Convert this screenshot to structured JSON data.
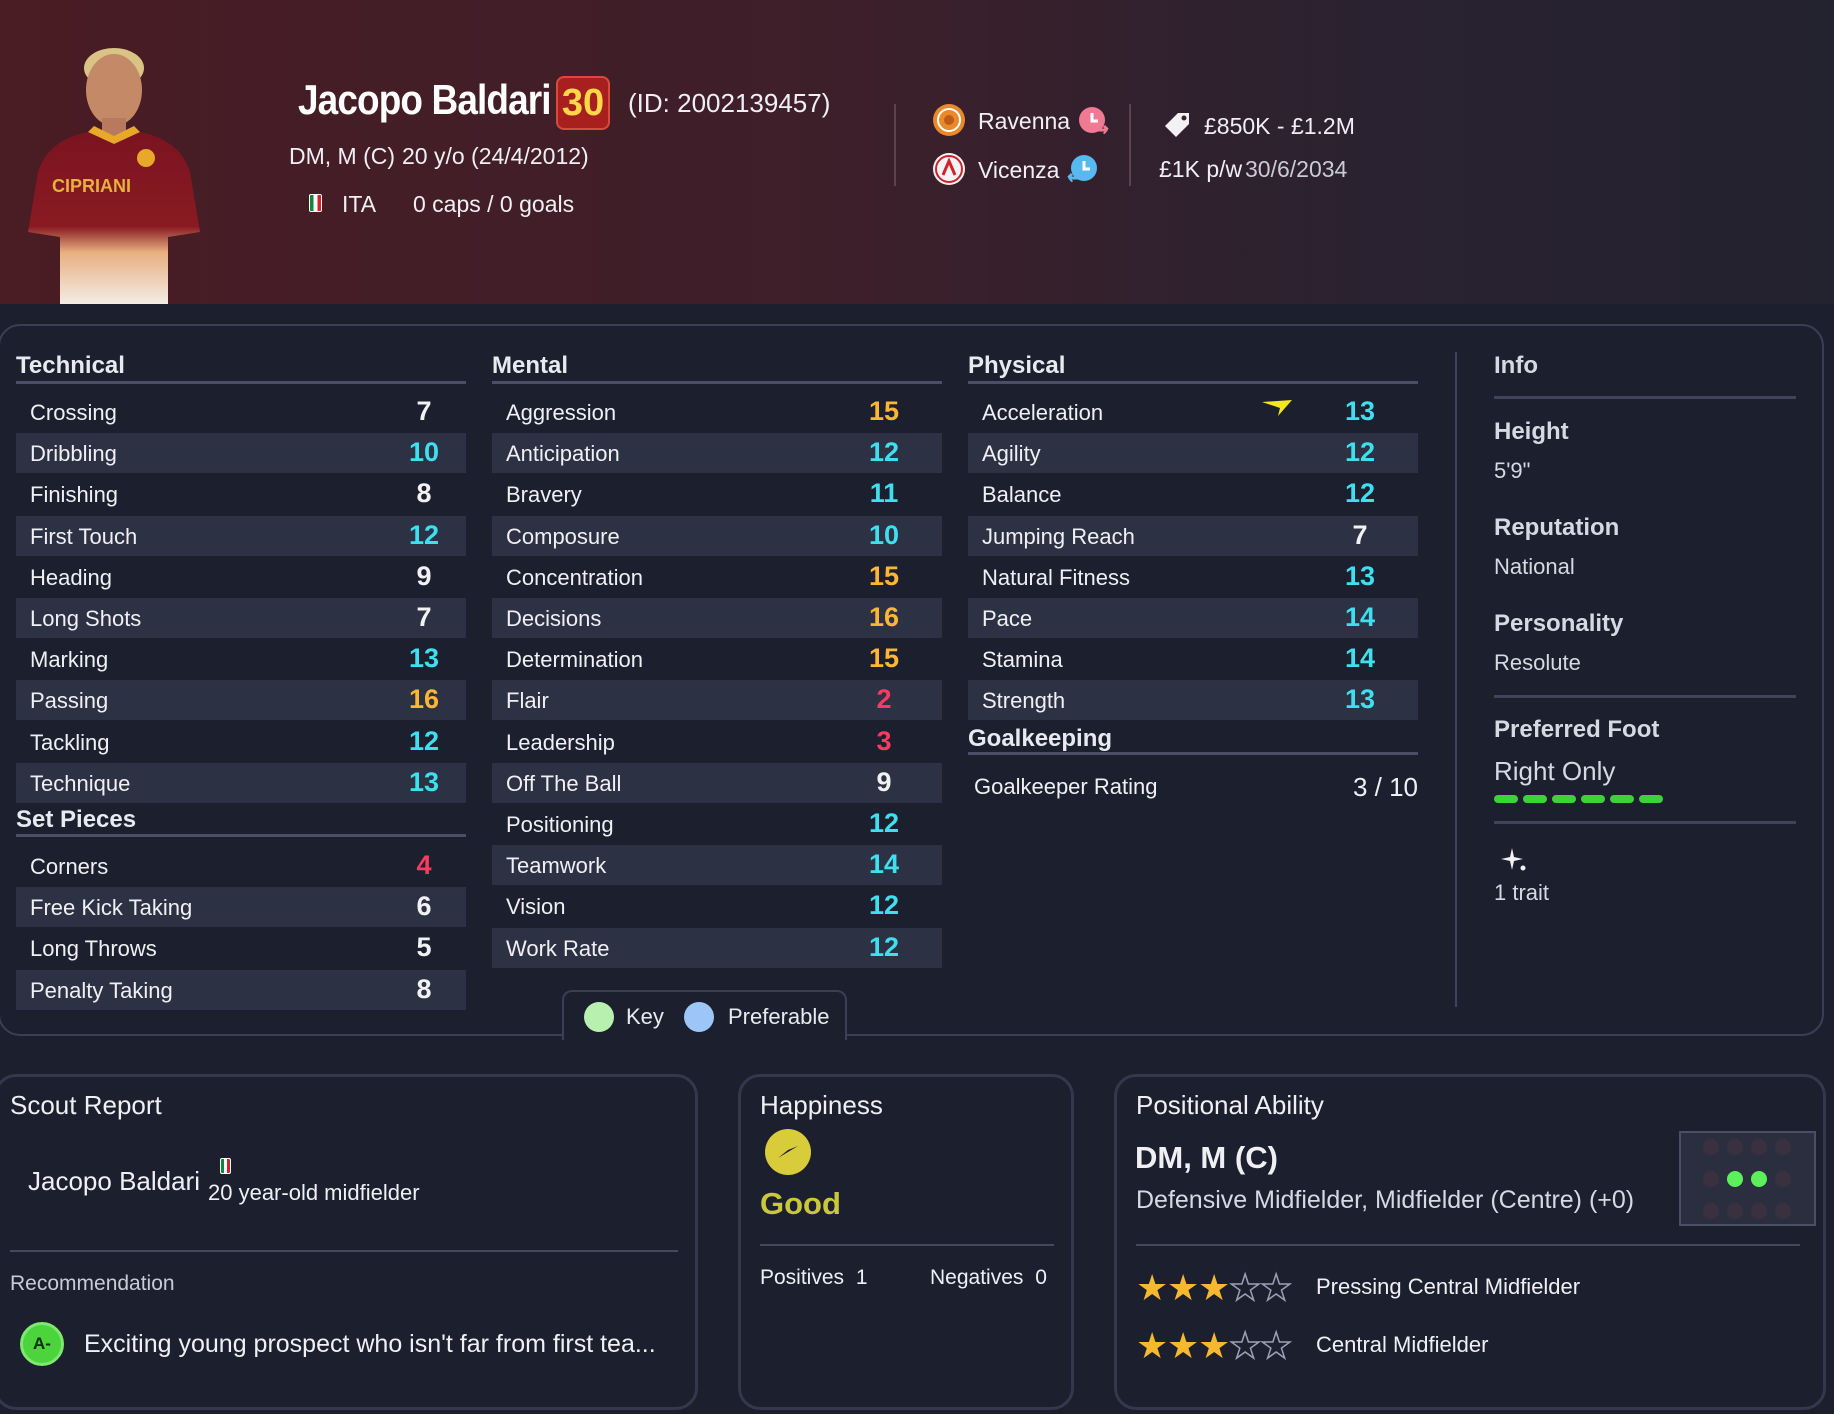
{
  "player": {
    "name": "Jacopo Baldari",
    "ability_badge": "30",
    "id_text": "(ID: 2002139457)",
    "positions": "DM, M (C)",
    "age": "20 y/o (24/4/2012)",
    "nation": "ITA",
    "caps": "0 caps / 0 goals"
  },
  "clubs": {
    "club1": "Ravenna",
    "club2": "Vicenza"
  },
  "contract": {
    "value": "£850K - £1.2M",
    "wage": "£1K p/w",
    "expiry": "30/6/2034"
  },
  "technical": {
    "title": "Technical",
    "rows": [
      {
        "label": "Crossing",
        "value": "7",
        "color": "#f2f2f4"
      },
      {
        "label": "Dribbling",
        "value": "10",
        "color": "#3ee0f0"
      },
      {
        "label": "Finishing",
        "value": "8",
        "color": "#f2f2f4"
      },
      {
        "label": "First Touch",
        "value": "12",
        "color": "#3ee0f0"
      },
      {
        "label": "Heading",
        "value": "9",
        "color": "#f2f2f4"
      },
      {
        "label": "Long Shots",
        "value": "7",
        "color": "#f2f2f4"
      },
      {
        "label": "Marking",
        "value": "13",
        "color": "#3ee0f0"
      },
      {
        "label": "Passing",
        "value": "16",
        "color": "#ffb632"
      },
      {
        "label": "Tackling",
        "value": "12",
        "color": "#3ee0f0"
      },
      {
        "label": "Technique",
        "value": "13",
        "color": "#3ee0f0"
      }
    ]
  },
  "set_pieces": {
    "title": "Set Pieces",
    "rows": [
      {
        "label": "Corners",
        "value": "4",
        "color": "#ff3a60"
      },
      {
        "label": "Free Kick Taking",
        "value": "6",
        "color": "#f2f2f4"
      },
      {
        "label": "Long Throws",
        "value": "5",
        "color": "#f2f2f4"
      },
      {
        "label": "Penalty Taking",
        "value": "8",
        "color": "#f2f2f4"
      }
    ]
  },
  "mental": {
    "title": "Mental",
    "rows": [
      {
        "label": "Aggression",
        "value": "15",
        "color": "#ffb632"
      },
      {
        "label": "Anticipation",
        "value": "12",
        "color": "#3ee0f0"
      },
      {
        "label": "Bravery",
        "value": "11",
        "color": "#3ee0f0"
      },
      {
        "label": "Composure",
        "value": "10",
        "color": "#3ee0f0"
      },
      {
        "label": "Concentration",
        "value": "15",
        "color": "#ffb632"
      },
      {
        "label": "Decisions",
        "value": "16",
        "color": "#ffb632"
      },
      {
        "label": "Determination",
        "value": "15",
        "color": "#ffb632"
      },
      {
        "label": "Flair",
        "value": "2",
        "color": "#ff3a60"
      },
      {
        "label": "Leadership",
        "value": "3",
        "color": "#ff3a60"
      },
      {
        "label": "Off The Ball",
        "value": "9",
        "color": "#f2f2f4"
      },
      {
        "label": "Positioning",
        "value": "12",
        "color": "#3ee0f0"
      },
      {
        "label": "Teamwork",
        "value": "14",
        "color": "#3ee0f0"
      },
      {
        "label": "Vision",
        "value": "12",
        "color": "#3ee0f0"
      },
      {
        "label": "Work Rate",
        "value": "12",
        "color": "#3ee0f0"
      }
    ]
  },
  "physical": {
    "title": "Physical",
    "rows": [
      {
        "label": "Acceleration",
        "value": "13",
        "color": "#3ee0f0"
      },
      {
        "label": "Agility",
        "value": "12",
        "color": "#3ee0f0"
      },
      {
        "label": "Balance",
        "value": "12",
        "color": "#3ee0f0"
      },
      {
        "label": "Jumping Reach",
        "value": "7",
        "color": "#f2f2f4"
      },
      {
        "label": "Natural Fitness",
        "value": "13",
        "color": "#3ee0f0"
      },
      {
        "label": "Pace",
        "value": "14",
        "color": "#3ee0f0"
      },
      {
        "label": "Stamina",
        "value": "14",
        "color": "#3ee0f0"
      },
      {
        "label": "Strength",
        "value": "13",
        "color": "#3ee0f0"
      }
    ]
  },
  "goalkeeping": {
    "title": "Goalkeeping",
    "label": "Goalkeeper Rating",
    "value": "3 / 10"
  },
  "info": {
    "title": "Info",
    "height_label": "Height",
    "height": "5'9\"",
    "reputation_label": "Reputation",
    "reputation": "National",
    "personality_label": "Personality",
    "personality": "Resolute",
    "foot_label": "Preferred Foot",
    "foot": "Right Only",
    "foot_level": 6,
    "traits": "1 trait"
  },
  "legend": {
    "key": "Key",
    "preferable": "Preferable"
  },
  "scout": {
    "title": "Scout Report",
    "name": "Jacopo Baldari",
    "summary": "20 year-old midfielder",
    "rec_label": "Recommendation",
    "grade": "A-",
    "text": "Exciting young prospect who isn't far from first tea..."
  },
  "happiness": {
    "title": "Happiness",
    "status": "Good",
    "positives_label": "Positives",
    "positives": "1",
    "negatives_label": "Negatives",
    "negatives": "0"
  },
  "positional": {
    "title": "Positional Ability",
    "positions": "DM, M (C)",
    "description": "Defensive Midfielder, Midfielder (Centre) (+0)",
    "roles": [
      {
        "name": "Pressing Central Midfielder",
        "stars": 3,
        "max": 5
      },
      {
        "name": "Central Midfielder",
        "stars": 3,
        "max": 5
      }
    ]
  },
  "icons": {
    "flag": "italy-flag-icon",
    "club1": "ravenna-crest-icon",
    "club2": "vicenza-crest-icon",
    "loan": "loan-arrow-icon",
    "value_tag": "price-tag-icon",
    "trait": "sparkle-icon",
    "happiness": "happy-face-icon",
    "acceleration": "lightning-arrow-icon"
  }
}
